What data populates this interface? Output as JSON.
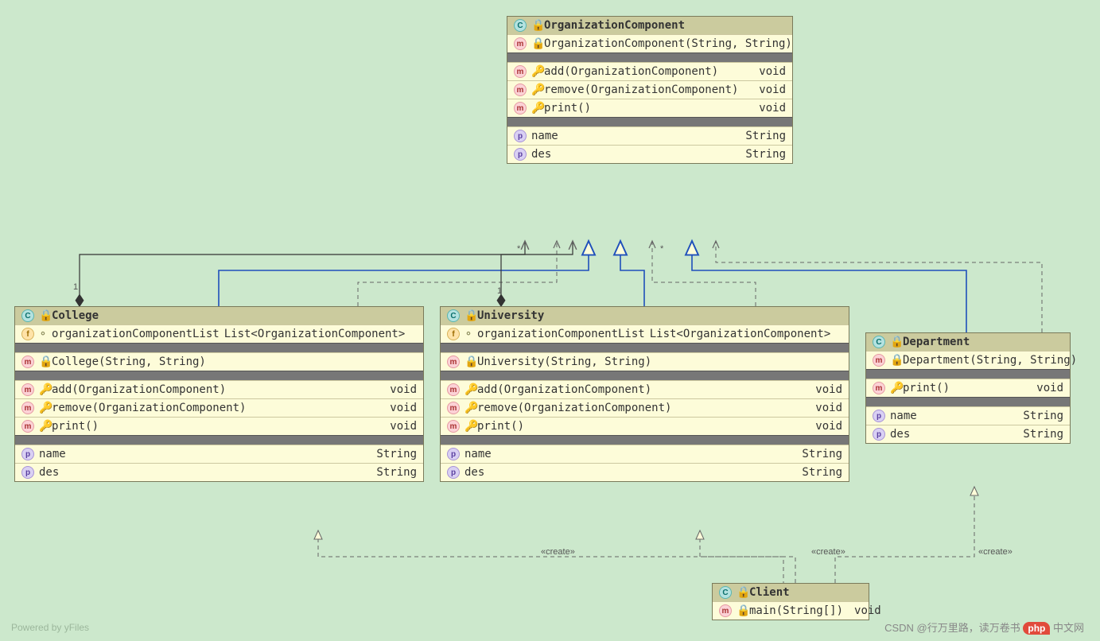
{
  "diagram": {
    "footer": "Powered by yFiles",
    "watermark_author": "CSDN @行万里路，读万卷书",
    "watermark_brand": "php",
    "watermark_site": "中文网"
  },
  "types": {
    "void": "void",
    "string": "String",
    "list": "List<OrganizationComponent>"
  },
  "labels": {
    "create": "«create»",
    "one_a": "1",
    "one_b": "1",
    "star_a": "*",
    "star_b": "*"
  },
  "classes": {
    "org": {
      "name": "OrganizationComponent",
      "ctor": "OrganizationComponent(String, String)",
      "m_add": "add(OrganizationComponent)",
      "m_remove": "remove(OrganizationComponent)",
      "m_print": "print()",
      "p_name": "name",
      "p_des": "des"
    },
    "college": {
      "name": "College",
      "f_list": "organizationComponentList",
      "ctor": "College(String, String)",
      "m_add": "add(OrganizationComponent)",
      "m_remove": "remove(OrganizationComponent)",
      "m_print": "print()",
      "p_name": "name",
      "p_des": "des"
    },
    "university": {
      "name": "University",
      "f_list": "organizationComponentList",
      "ctor": "University(String, String)",
      "m_add": "add(OrganizationComponent)",
      "m_remove": "remove(OrganizationComponent)",
      "m_print": "print()",
      "p_name": "name",
      "p_des": "des"
    },
    "department": {
      "name": "Department",
      "ctor": "Department(String, String)",
      "m_print": "print()",
      "p_name": "name",
      "p_des": "des"
    },
    "client": {
      "name": "Client",
      "m_main": "main(String[])"
    }
  }
}
